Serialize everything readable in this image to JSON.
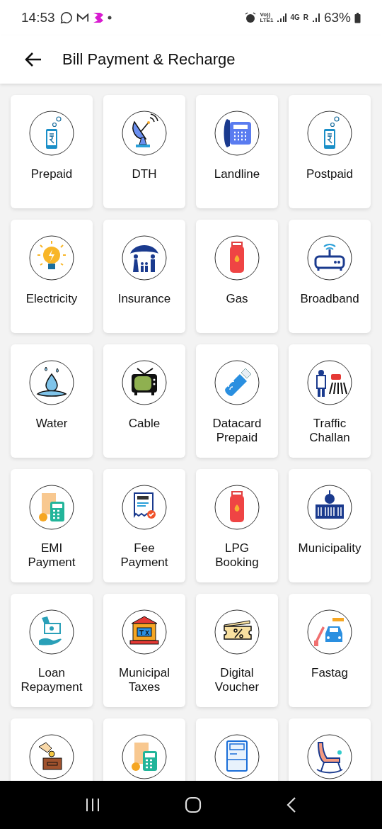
{
  "status_bar": {
    "time": "14:53",
    "volte": "Vo))",
    "lte": "LTE1",
    "network": "4G",
    "roaming": "R",
    "battery": "63%"
  },
  "header": {
    "title": "Bill Payment & Recharge"
  },
  "tiles": [
    {
      "kind": "service",
      "label": "Prepaid"
    },
    {
      "kind": "service",
      "label": "DTH"
    },
    {
      "kind": "service",
      "label": "Landline"
    },
    {
      "kind": "service",
      "label": "Postpaid"
    },
    {
      "kind": "service",
      "label": "Electricity"
    },
    {
      "kind": "service",
      "label": "Insurance"
    },
    {
      "kind": "service",
      "label": "Gas"
    },
    {
      "kind": "service",
      "label": "Broadband"
    },
    {
      "kind": "service",
      "label": "Water"
    },
    {
      "kind": "service",
      "label": "Cable"
    },
    {
      "kind": "service",
      "label": "Datacard\nPrepaid"
    },
    {
      "kind": "service",
      "label": "Traffic\nChallan"
    },
    {
      "kind": "service",
      "label": "EMI\nPayment"
    },
    {
      "kind": "service",
      "label": "Fee\nPayment"
    },
    {
      "kind": "service",
      "label": "LPG\nBooking"
    },
    {
      "kind": "service",
      "label": "Municipality"
    },
    {
      "kind": "service",
      "label": "Loan\nRepayment"
    },
    {
      "kind": "service",
      "label": "Municipal\nTaxes"
    },
    {
      "kind": "service",
      "label": "Digital\nVoucher"
    },
    {
      "kind": "service",
      "label": "Fastag"
    },
    {
      "kind": "cut-off"
    },
    {
      "kind": "cut-off"
    },
    {
      "kind": "cut-off"
    },
    {
      "kind": "cut-off"
    }
  ]
}
